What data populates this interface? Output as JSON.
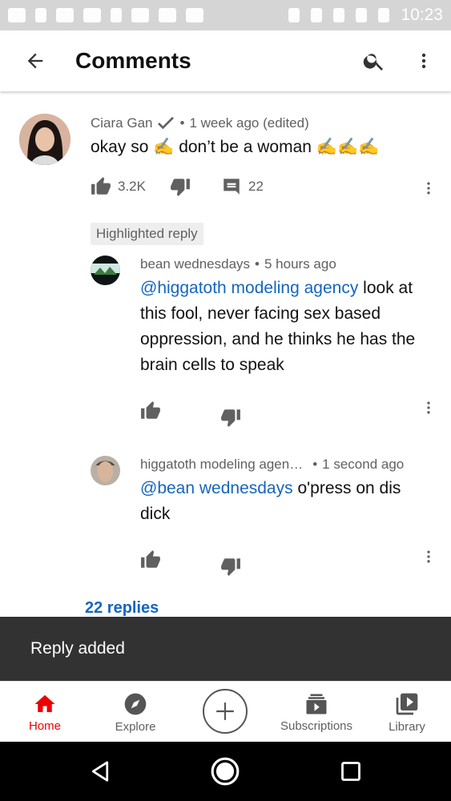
{
  "status_bar": {
    "time": "10:23"
  },
  "header": {
    "title": "Comments"
  },
  "comment": {
    "author": "Ciara Gan",
    "verified_icon": "check-icon",
    "separator": "•",
    "time": "1 week ago (edited)",
    "text": "okay so ✍️ don’t be a woman ✍️✍️✍️",
    "likes": "3.2K",
    "reply_count": "22"
  },
  "highlighted_label": "Highlighted reply",
  "replies": [
    {
      "author": "bean wednesdays",
      "separator": "•",
      "time": "5 hours ago",
      "mention": "@higgatoth modeling agency",
      "text": " look at this fool, never facing sex based oppression, and he thinks he has the brain cells to speak"
    },
    {
      "author": "higgatoth modeling agen…",
      "separator": "•",
      "time": "1 second ago",
      "mention": "@bean wednesdays",
      "text": " o'press on dis dick"
    }
  ],
  "replies_link": "22 replies",
  "snackbar": {
    "message": "Reply added"
  },
  "bottom_nav": {
    "items": [
      {
        "label": "Home",
        "icon": "home-icon",
        "active": true
      },
      {
        "label": "Explore",
        "icon": "compass-icon",
        "active": false
      },
      {
        "label": "",
        "icon": "create-icon",
        "active": false
      },
      {
        "label": "Subscriptions",
        "icon": "subscriptions-icon",
        "active": false
      },
      {
        "label": "Library",
        "icon": "library-icon",
        "active": false
      }
    ]
  },
  "colors": {
    "accent_red": "#ee0000",
    "link_blue": "#1565c0",
    "snackbar_bg": "#323232"
  }
}
